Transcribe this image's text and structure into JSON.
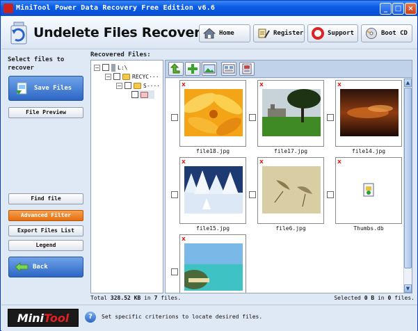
{
  "window": {
    "title": "MiniTool Power Data Recovery Free Edition v6.6",
    "minimize_icon": "minimize-icon",
    "maximize_icon": "maximize-icon",
    "close_icon": "close-icon"
  },
  "header": {
    "title": "Undelete Files Recovery",
    "nav": [
      {
        "label": "Home",
        "icon": "home-icon"
      },
      {
        "label": "Register",
        "icon": "register-icon"
      },
      {
        "label": "Support",
        "icon": "lifebuoy-icon"
      },
      {
        "label": "Boot CD",
        "icon": "boot-cd-icon"
      }
    ]
  },
  "sidebar": {
    "select_title": "Select files to recover",
    "save_label": "Save Files",
    "file_preview": "File Preview",
    "find_file": "Find file",
    "advanced_filter": "Advanced Filter",
    "export_list": "Export Files List",
    "legend": "Legend",
    "back_label": "Back"
  },
  "main": {
    "recovered_label": "Recovered Files:",
    "tree": [
      {
        "label": "L:\\",
        "level": 0
      },
      {
        "label": "RECYC···",
        "level": 1
      },
      {
        "label": "S-···",
        "level": 2
      },
      {
        "label": "",
        "level": 3
      }
    ],
    "toolbar_icons": [
      "up-folder-icon",
      "add-icon",
      "image-view-icon",
      "thumbnail-view-icon",
      "preview-icon"
    ],
    "files": [
      {
        "name": "file18.jpg",
        "thumb": "orange-flower"
      },
      {
        "name": "file17.jpg",
        "thumb": "castle-lawn"
      },
      {
        "name": "file14.jpg",
        "thumb": "sunset-clouds"
      },
      {
        "name": "file15.jpg",
        "thumb": "snowy-forest"
      },
      {
        "name": "file6.jpg",
        "thumb": "dry-leaves"
      },
      {
        "name": "Thumbs.db",
        "thumb": "generic-file-icon"
      },
      {
        "name": "",
        "thumb": "tropical-beach"
      }
    ],
    "status": {
      "total_prefix": "Total",
      "total_size": "328.52 KB",
      "total_mid": "in",
      "total_count": "7",
      "total_suffix": "files.",
      "selected_prefix": "Selected",
      "selected_size": "0 B",
      "selected_mid": "in",
      "selected_count": "0",
      "selected_suffix": "files."
    }
  },
  "footer": {
    "brand_mini": "Mini",
    "brand_tool": "Tool",
    "hint": "Set specific criterions to locate desired files."
  }
}
